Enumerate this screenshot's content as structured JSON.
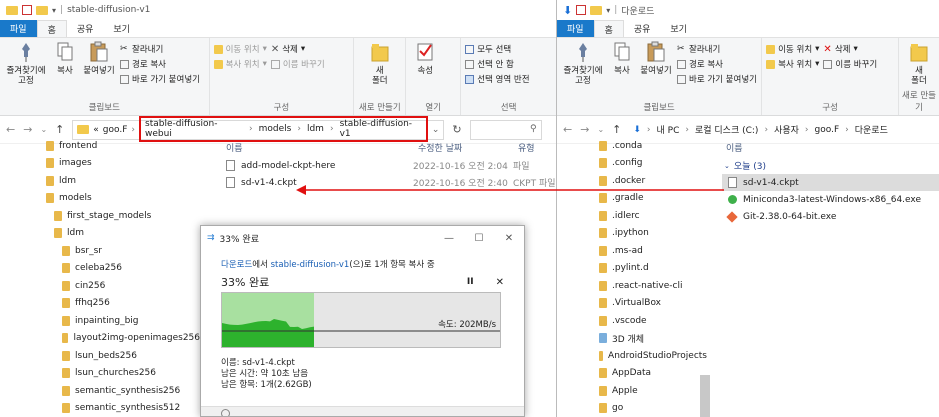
{
  "left": {
    "title": "stable-diffusion-v1",
    "tabs": [
      "파일",
      "홈",
      "공유",
      "보기"
    ],
    "ribbon": {
      "pin": "즐겨찾기에\n고정",
      "copy": "복사",
      "paste": "붙여넣기",
      "cut": "잘라내기",
      "copy_path": "경로 복사",
      "paste_shortcut": "바로 가기 붙여넣기",
      "clipboard_group": "클립보드",
      "move_to": "이동 위치",
      "copy_to": "복사 위치",
      "delete": "삭제",
      "rename": "이름 바꾸기",
      "organize_group": "구성",
      "new_folder": "새\n폴더",
      "new_group": "새로 만들기",
      "properties": "속성",
      "open_group": "열기",
      "select_all": "모두 선택",
      "select_none": "선택 안 함",
      "invert": "선택 영역 반전",
      "select_group": "선택"
    },
    "address": [
      "«",
      "goo.F",
      "stable-diffusion-webui",
      "models",
      "ldm",
      "stable-diffusion-v1"
    ],
    "nav": [
      {
        "label": "frontend",
        "indent": 0
      },
      {
        "label": "images",
        "indent": 0
      },
      {
        "label": "ldm",
        "indent": 0
      },
      {
        "label": "models",
        "indent": 0
      },
      {
        "label": "first_stage_models",
        "indent": 1
      },
      {
        "label": "ldm",
        "indent": 1
      },
      {
        "label": "bsr_sr",
        "indent": 2
      },
      {
        "label": "celeba256",
        "indent": 2
      },
      {
        "label": "cin256",
        "indent": 2
      },
      {
        "label": "ffhq256",
        "indent": 2
      },
      {
        "label": "inpainting_big",
        "indent": 2
      },
      {
        "label": "layout2img-openimages256",
        "indent": 2
      },
      {
        "label": "lsun_beds256",
        "indent": 2
      },
      {
        "label": "lsun_churches256",
        "indent": 2
      },
      {
        "label": "semantic_synthesis256",
        "indent": 2
      },
      {
        "label": "semantic_synthesis512",
        "indent": 2
      }
    ],
    "columns": {
      "name": "이름",
      "date": "수정한 날짜",
      "type": "유형"
    },
    "files": [
      {
        "name": "add-model-ckpt-here",
        "date": "2022-10-16 오전 2:04",
        "type": "파일"
      },
      {
        "name": "sd-v1-4.ckpt",
        "date": "2022-10-16 오전 2:40",
        "type": "CKPT 파일"
      }
    ]
  },
  "right": {
    "title": "다운로드",
    "tabs": [
      "파일",
      "홈",
      "공유",
      "보기"
    ],
    "ribbon": {
      "pin": "즐겨찾기에\n고정",
      "copy": "복사",
      "paste": "붙여넣기",
      "cut": "잘라내기",
      "copy_path": "경로 복사",
      "paste_shortcut": "바로 가기 붙여넣기",
      "clipboard_group": "클립보드",
      "move_to": "이동 위치",
      "copy_to": "복사 위치",
      "delete": "삭제",
      "rename": "이름 바꾸기",
      "organize_group": "구성",
      "new_folder": "새\n폴더",
      "new_group": "새로 만들기"
    },
    "address": [
      "내 PC",
      "로컬 디스크 (C:)",
      "사용자",
      "goo.F",
      "다운로드"
    ],
    "nav": [
      ".conda",
      ".config",
      ".docker",
      ".gradle",
      ".idlerc",
      ".ipython",
      ".ms-ad",
      ".pylint.d",
      ".react-native-cli",
      ".VirtualBox",
      ".vscode",
      "3D 개체",
      "AndroidStudioProjects",
      "AppData",
      "Apple",
      "go"
    ],
    "columns": {
      "name": "이름"
    },
    "group_label": "오늘 (3)",
    "files": [
      "sd-v1-4.ckpt",
      "Miniconda3-latest-Windows-x86_64.exe",
      "Git-2.38.0-64-bit.exe"
    ]
  },
  "dialog": {
    "title": "33% 완료",
    "line_from": "다운로드",
    "line_mid": "에서 ",
    "line_to": "stable-diffusion-v1",
    "line_end": "(으)로 1개 항목 복사 중",
    "heading": "33% 완료",
    "progress": 0.33,
    "speed": "속도: 202MB/s",
    "name": "이름: sd-v1-4.ckpt",
    "time_left": "남은 시간: 약 10초 남음",
    "items_left": "남은 항목: 1개(2.62GB)"
  },
  "colors": {
    "file_tab": "#1979ca",
    "highlight_red": "#e01010",
    "graph_green": "#2db22d",
    "graph_light": "#a8e0a0"
  }
}
